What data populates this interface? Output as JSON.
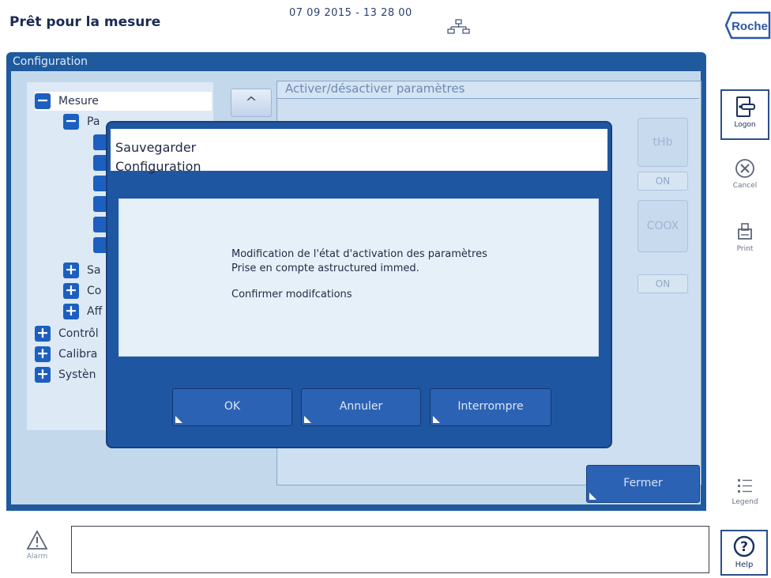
{
  "header": {
    "status_title": "Prêt pour la mesure",
    "datetime": "07 09 2015 - 13 28 00",
    "brand": "Roche"
  },
  "toolbar": {
    "logon_label": "Logon",
    "cancel_label": "Cancel",
    "print_label": "Print",
    "legend_label": "Legend",
    "help_label": "Help",
    "alarm_label": "Alarm"
  },
  "config": {
    "title": "Configuration",
    "tree": [
      {
        "label": "Mesure",
        "sign": "−"
      },
      {
        "label": "Pa",
        "sign": "−"
      },
      {
        "label": "",
        "sign": ""
      },
      {
        "label": "",
        "sign": ""
      },
      {
        "label": "",
        "sign": ""
      },
      {
        "label": "",
        "sign": ""
      },
      {
        "label": "",
        "sign": ""
      },
      {
        "label": "",
        "sign": ""
      },
      {
        "label": "Sa",
        "sign": "+"
      },
      {
        "label": "Co",
        "sign": "+"
      },
      {
        "label": "Aff",
        "sign": "+"
      },
      {
        "label": "Contrôl",
        "sign": "+"
      },
      {
        "label": "Calibra",
        "sign": "+"
      },
      {
        "label": "Systèn",
        "sign": "+"
      }
    ],
    "scroll_up": "^",
    "panel_header": "Activer/désactiver paramètres",
    "params": [
      {
        "name": "tHb",
        "state": "ON"
      },
      {
        "name": "COOX",
        "state": "ON"
      }
    ],
    "close_label": "Fermer"
  },
  "dialog": {
    "title_line1": "Sauvegarder",
    "title_line2": "Configuration",
    "message_line1": "Modification de l'état d'activation des paramètres",
    "message_line2": "Prise en compte astructured immed.",
    "message_line3": "Confirmer modifcations",
    "ok_label": "OK",
    "cancel_label": "Annuler",
    "abort_label": "Interrompre"
  },
  "colors": {
    "window_blue": "#1f5a9f",
    "dialog_blue": "#1f56a2",
    "button_blue": "#2c62b4",
    "tree_icon_blue": "#1c5fbf",
    "panel_light": "#c4d8ec"
  }
}
